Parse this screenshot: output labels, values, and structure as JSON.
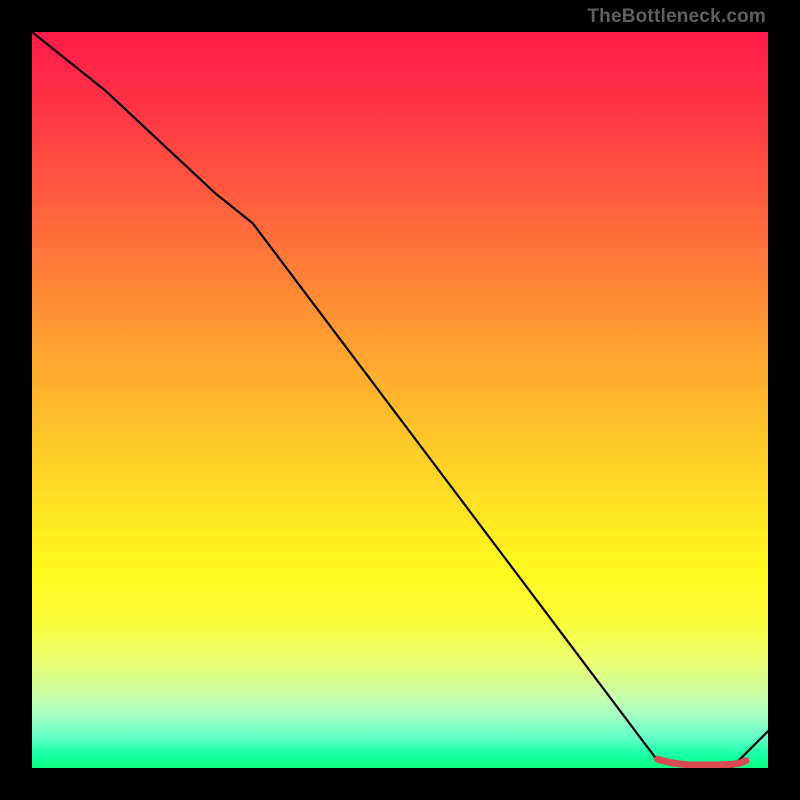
{
  "credit": "TheBottleneck.com",
  "chart_data": {
    "type": "line",
    "title": "",
    "xlabel": "",
    "ylabel": "",
    "xlim": [
      0,
      100
    ],
    "ylim": [
      0,
      100
    ],
    "series": [
      {
        "name": "curve",
        "x": [
          0,
          10,
          25,
          30,
          85,
          90,
          95,
          100
        ],
        "y": [
          100,
          92,
          78,
          74,
          1,
          0,
          0,
          5
        ],
        "stroke": "#000000",
        "width": 2.2
      },
      {
        "name": "marker-band",
        "x": [
          85,
          86,
          87,
          88,
          89,
          90,
          91,
          92,
          93,
          94,
          95,
          96,
          97
        ],
        "y": [
          1.2,
          0.9,
          0.7,
          0.55,
          0.45,
          0.4,
          0.4,
          0.4,
          0.4,
          0.45,
          0.5,
          0.6,
          1.0
        ],
        "stroke": "#d94a52",
        "width": 7.0
      }
    ]
  }
}
